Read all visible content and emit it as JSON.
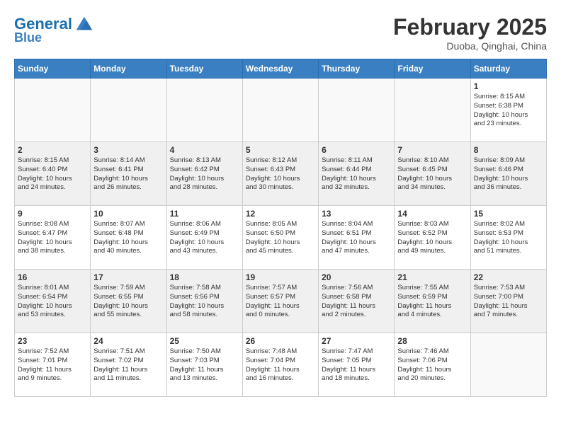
{
  "header": {
    "logo_line1": "General",
    "logo_line2": "Blue",
    "month_title": "February 2025",
    "location": "Duoba, Qinghai, China"
  },
  "weekdays": [
    "Sunday",
    "Monday",
    "Tuesday",
    "Wednesday",
    "Thursday",
    "Friday",
    "Saturday"
  ],
  "weeks": [
    [
      {
        "day": "",
        "info": ""
      },
      {
        "day": "",
        "info": ""
      },
      {
        "day": "",
        "info": ""
      },
      {
        "day": "",
        "info": ""
      },
      {
        "day": "",
        "info": ""
      },
      {
        "day": "",
        "info": ""
      },
      {
        "day": "1",
        "info": "Sunrise: 8:15 AM\nSunset: 6:38 PM\nDaylight: 10 hours\nand 23 minutes."
      }
    ],
    [
      {
        "day": "2",
        "info": "Sunrise: 8:15 AM\nSunset: 6:40 PM\nDaylight: 10 hours\nand 24 minutes."
      },
      {
        "day": "3",
        "info": "Sunrise: 8:14 AM\nSunset: 6:41 PM\nDaylight: 10 hours\nand 26 minutes."
      },
      {
        "day": "4",
        "info": "Sunrise: 8:13 AM\nSunset: 6:42 PM\nDaylight: 10 hours\nand 28 minutes."
      },
      {
        "day": "5",
        "info": "Sunrise: 8:12 AM\nSunset: 6:43 PM\nDaylight: 10 hours\nand 30 minutes."
      },
      {
        "day": "6",
        "info": "Sunrise: 8:11 AM\nSunset: 6:44 PM\nDaylight: 10 hours\nand 32 minutes."
      },
      {
        "day": "7",
        "info": "Sunrise: 8:10 AM\nSunset: 6:45 PM\nDaylight: 10 hours\nand 34 minutes."
      },
      {
        "day": "8",
        "info": "Sunrise: 8:09 AM\nSunset: 6:46 PM\nDaylight: 10 hours\nand 36 minutes."
      }
    ],
    [
      {
        "day": "9",
        "info": "Sunrise: 8:08 AM\nSunset: 6:47 PM\nDaylight: 10 hours\nand 38 minutes."
      },
      {
        "day": "10",
        "info": "Sunrise: 8:07 AM\nSunset: 6:48 PM\nDaylight: 10 hours\nand 40 minutes."
      },
      {
        "day": "11",
        "info": "Sunrise: 8:06 AM\nSunset: 6:49 PM\nDaylight: 10 hours\nand 43 minutes."
      },
      {
        "day": "12",
        "info": "Sunrise: 8:05 AM\nSunset: 6:50 PM\nDaylight: 10 hours\nand 45 minutes."
      },
      {
        "day": "13",
        "info": "Sunrise: 8:04 AM\nSunset: 6:51 PM\nDaylight: 10 hours\nand 47 minutes."
      },
      {
        "day": "14",
        "info": "Sunrise: 8:03 AM\nSunset: 6:52 PM\nDaylight: 10 hours\nand 49 minutes."
      },
      {
        "day": "15",
        "info": "Sunrise: 8:02 AM\nSunset: 6:53 PM\nDaylight: 10 hours\nand 51 minutes."
      }
    ],
    [
      {
        "day": "16",
        "info": "Sunrise: 8:01 AM\nSunset: 6:54 PM\nDaylight: 10 hours\nand 53 minutes."
      },
      {
        "day": "17",
        "info": "Sunrise: 7:59 AM\nSunset: 6:55 PM\nDaylight: 10 hours\nand 55 minutes."
      },
      {
        "day": "18",
        "info": "Sunrise: 7:58 AM\nSunset: 6:56 PM\nDaylight: 10 hours\nand 58 minutes."
      },
      {
        "day": "19",
        "info": "Sunrise: 7:57 AM\nSunset: 6:57 PM\nDaylight: 11 hours\nand 0 minutes."
      },
      {
        "day": "20",
        "info": "Sunrise: 7:56 AM\nSunset: 6:58 PM\nDaylight: 11 hours\nand 2 minutes."
      },
      {
        "day": "21",
        "info": "Sunrise: 7:55 AM\nSunset: 6:59 PM\nDaylight: 11 hours\nand 4 minutes."
      },
      {
        "day": "22",
        "info": "Sunrise: 7:53 AM\nSunset: 7:00 PM\nDaylight: 11 hours\nand 7 minutes."
      }
    ],
    [
      {
        "day": "23",
        "info": "Sunrise: 7:52 AM\nSunset: 7:01 PM\nDaylight: 11 hours\nand 9 minutes."
      },
      {
        "day": "24",
        "info": "Sunrise: 7:51 AM\nSunset: 7:02 PM\nDaylight: 11 hours\nand 11 minutes."
      },
      {
        "day": "25",
        "info": "Sunrise: 7:50 AM\nSunset: 7:03 PM\nDaylight: 11 hours\nand 13 minutes."
      },
      {
        "day": "26",
        "info": "Sunrise: 7:48 AM\nSunset: 7:04 PM\nDaylight: 11 hours\nand 16 minutes."
      },
      {
        "day": "27",
        "info": "Sunrise: 7:47 AM\nSunset: 7:05 PM\nDaylight: 11 hours\nand 18 minutes."
      },
      {
        "day": "28",
        "info": "Sunrise: 7:46 AM\nSunset: 7:06 PM\nDaylight: 11 hours\nand 20 minutes."
      },
      {
        "day": "",
        "info": ""
      }
    ]
  ]
}
